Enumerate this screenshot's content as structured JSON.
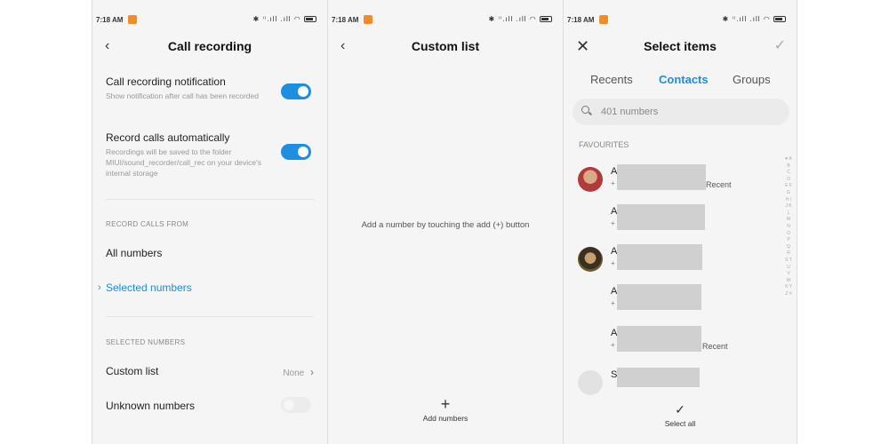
{
  "status_bar": {
    "time": "7:18 AM",
    "icons_text": "✱ ⁱⁱ.ıll .ıll ◠"
  },
  "screen1": {
    "title": "Call recording",
    "notification_title": "Call recording notification",
    "notification_sub": "Show notification after call has been recorded",
    "auto_title": "Record calls automatically",
    "auto_sub": "Recordings will be saved to the folder MIUI/sound_recorder/call_rec on your device's internal storage",
    "section_from": "RECORD CALLS FROM",
    "all_numbers": "All numbers",
    "selected_numbers": "Selected numbers",
    "section_selected": "SELECTED NUMBERS",
    "custom_list": "Custom list",
    "custom_list_value": "None",
    "unknown_numbers": "Unknown numbers",
    "toggles": {
      "notification": true,
      "auto": true,
      "unknown": false
    }
  },
  "screen2": {
    "title": "Custom list",
    "hint": "Add a number by touching the add (+) button",
    "add_icon": "+",
    "add_label": "Add numbers"
  },
  "screen3": {
    "title": "Select items",
    "tabs": [
      "Recents",
      "Contacts",
      "Groups"
    ],
    "active_tab": "Contacts",
    "search_placeholder": "401 numbers",
    "favourites_label": "FAVOURITES",
    "contacts": [
      {
        "initial": "A",
        "plus": "+",
        "recent": "Recent"
      },
      {
        "initial": "A",
        "plus": "+",
        "recent": ""
      },
      {
        "initial": "A",
        "plus": "+",
        "recent": ""
      },
      {
        "initial": "A",
        "plus": "+",
        "recent": ""
      },
      {
        "initial": "A",
        "plus": "+",
        "recent": "Recent"
      },
      {
        "initial": "S",
        "plus": "",
        "recent": ""
      }
    ],
    "alphabet": "♥ A B C D E F G H I J K L M N O P Q R S T U V W X Y Z #",
    "select_all_icon": "✓",
    "select_all_label": "Select all"
  },
  "colors": {
    "accent": "#1f8ed8",
    "toggle_on": "#1e8fe0",
    "notif": "#f28c28"
  }
}
